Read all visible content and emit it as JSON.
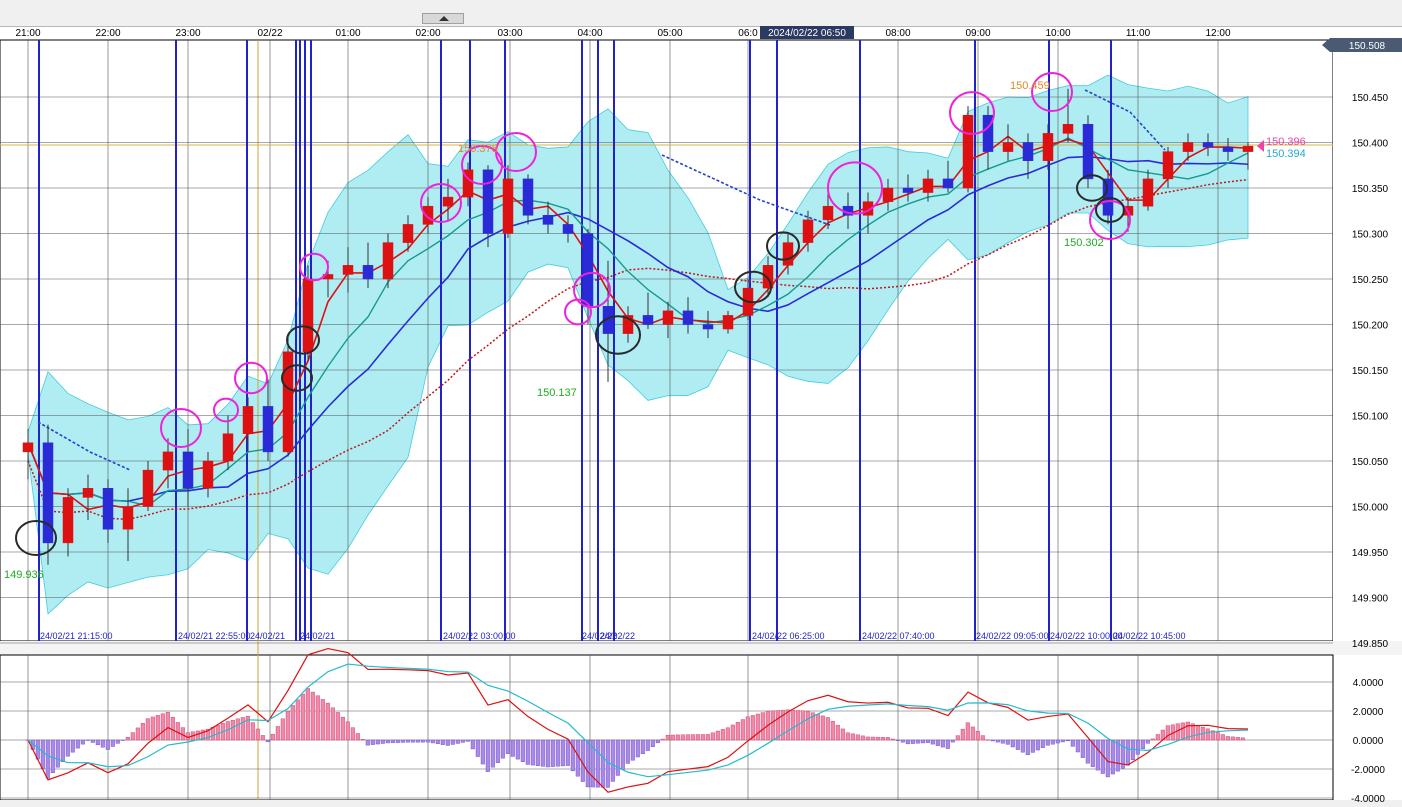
{
  "time_labels": [
    "21:00",
    "22:00",
    "23:00",
    "02/22",
    "01:00",
    "02:00",
    "03:00",
    "04:00",
    "05:00",
    "06:0",
    "08:00",
    "09:00",
    "10:00",
    "11:00",
    "12:00"
  ],
  "cursor_label": "2024/02/22 06:50",
  "price_axis": {
    "current_price_tag": "150.508",
    "ticks": [
      "150.450",
      "150.400",
      "150.350",
      "150.300",
      "150.250",
      "150.200",
      "150.150",
      "150.100",
      "150.050",
      "150.000",
      "149.950",
      "149.900",
      "149.850"
    ],
    "last_bid": "150.396",
    "last_ask": "150.394"
  },
  "annotations": {
    "low_1": "149.936",
    "low_2": "150.137",
    "high_1": "150.378",
    "high_2": "150.459",
    "low_3": "150.302"
  },
  "vline_labels": [
    "24/02/21 21:15:00",
    "24/02/21 22:55:00",
    "24/02/21",
    "24/02/21",
    "24/02/22 03:00:00",
    "24/02/22",
    "24/02/22",
    "24/02/22 06:25:00",
    "24/02/22 07:40:00",
    "24/02/22 09:05:00",
    "24/02/22 10:00:00",
    "24/02/22 10:45:00"
  ],
  "macd_axis": [
    "4.0000",
    "2.0000",
    "0.0000",
    "-2.0000",
    "-4.0000"
  ],
  "colors": {
    "bull_candle": "#dd1111",
    "bear_candle": "#2a2ad6",
    "band_fill": "#a8ecf2",
    "band_edge": "#2ec7d8",
    "ma_fast": "#dd1111",
    "ma_mid": "#169a8c",
    "ma_slow": "#2a2ad6",
    "event_line": "#2222cc",
    "highlight_circle": "#ee22dd",
    "support_circle": "#2a2a2a",
    "macd_line": "#dd1111",
    "signal_line": "#22bbcc",
    "hist_pos": "#f08aa8",
    "hist_neg": "#a98ae6"
  },
  "chart_data": {
    "type": "candlestick",
    "timeframe": "5m",
    "ylim": [
      149.85,
      150.51
    ],
    "series": [
      {
        "x": "21:00",
        "open": 150.06,
        "high": 150.085,
        "low": 150.03,
        "close": 150.07
      },
      {
        "x": "21:15",
        "open": 150.07,
        "high": 150.09,
        "low": 149.936,
        "close": 149.96
      },
      {
        "x": "21:30",
        "open": 149.96,
        "high": 150.02,
        "low": 149.945,
        "close": 150.01
      },
      {
        "x": "21:45",
        "open": 150.01,
        "high": 150.035,
        "low": 149.985,
        "close": 150.02
      },
      {
        "x": "22:00",
        "open": 150.02,
        "high": 150.03,
        "low": 149.96,
        "close": 149.975
      },
      {
        "x": "22:15",
        "open": 149.975,
        "high": 150.02,
        "low": 149.94,
        "close": 150.0
      },
      {
        "x": "22:30",
        "open": 150.0,
        "high": 150.05,
        "low": 149.995,
        "close": 150.04
      },
      {
        "x": "22:45",
        "open": 150.04,
        "high": 150.075,
        "low": 150.02,
        "close": 150.06
      },
      {
        "x": "23:00",
        "open": 150.06,
        "high": 150.085,
        "low": 150.0,
        "close": 150.02
      },
      {
        "x": "23:15",
        "open": 150.02,
        "high": 150.06,
        "low": 150.01,
        "close": 150.05
      },
      {
        "x": "23:30",
        "open": 150.05,
        "high": 150.1,
        "low": 150.04,
        "close": 150.08
      },
      {
        "x": "23:45",
        "open": 150.08,
        "high": 150.12,
        "low": 150.06,
        "close": 150.11
      },
      {
        "x": "00:00",
        "open": 150.11,
        "high": 150.14,
        "low": 150.05,
        "close": 150.06
      },
      {
        "x": "00:15",
        "open": 150.06,
        "high": 150.185,
        "low": 150.055,
        "close": 150.17
      },
      {
        "x": "00:30",
        "open": 150.17,
        "high": 150.265,
        "low": 150.16,
        "close": 150.25
      },
      {
        "x": "00:45",
        "open": 150.25,
        "high": 150.27,
        "low": 150.23,
        "close": 150.255
      },
      {
        "x": "01:00",
        "open": 150.255,
        "high": 150.285,
        "low": 150.235,
        "close": 150.265
      },
      {
        "x": "01:15",
        "open": 150.265,
        "high": 150.29,
        "low": 150.24,
        "close": 150.25
      },
      {
        "x": "01:30",
        "open": 150.25,
        "high": 150.3,
        "low": 150.24,
        "close": 150.29
      },
      {
        "x": "01:45",
        "open": 150.29,
        "high": 150.32,
        "low": 150.28,
        "close": 150.31
      },
      {
        "x": "02:00",
        "open": 150.31,
        "high": 150.34,
        "low": 150.3,
        "close": 150.33
      },
      {
        "x": "02:15",
        "open": 150.33,
        "high": 150.36,
        "low": 150.315,
        "close": 150.34
      },
      {
        "x": "02:30",
        "open": 150.34,
        "high": 150.378,
        "low": 150.33,
        "close": 150.37
      },
      {
        "x": "02:45",
        "open": 150.37,
        "high": 150.375,
        "low": 150.285,
        "close": 150.3
      },
      {
        "x": "03:00",
        "open": 150.3,
        "high": 150.375,
        "low": 150.295,
        "close": 150.36
      },
      {
        "x": "03:15",
        "open": 150.36,
        "high": 150.365,
        "low": 150.31,
        "close": 150.32
      },
      {
        "x": "03:30",
        "open": 150.32,
        "high": 150.335,
        "low": 150.3,
        "close": 150.31
      },
      {
        "x": "03:45",
        "open": 150.31,
        "high": 150.32,
        "low": 150.29,
        "close": 150.3
      },
      {
        "x": "04:00",
        "open": 150.3,
        "high": 150.305,
        "low": 150.2,
        "close": 150.22
      },
      {
        "x": "04:15",
        "open": 150.22,
        "high": 150.27,
        "low": 150.137,
        "close": 150.19
      },
      {
        "x": "04:30",
        "open": 150.19,
        "high": 150.22,
        "low": 150.18,
        "close": 150.21
      },
      {
        "x": "04:45",
        "open": 150.21,
        "high": 150.235,
        "low": 150.195,
        "close": 150.2
      },
      {
        "x": "05:00",
        "open": 150.2,
        "high": 150.225,
        "low": 150.185,
        "close": 150.215
      },
      {
        "x": "05:15",
        "open": 150.215,
        "high": 150.23,
        "low": 150.19,
        "close": 150.2
      },
      {
        "x": "05:30",
        "open": 150.2,
        "high": 150.215,
        "low": 150.185,
        "close": 150.195
      },
      {
        "x": "05:45",
        "open": 150.195,
        "high": 150.215,
        "low": 150.19,
        "close": 150.21
      },
      {
        "x": "06:00",
        "open": 150.21,
        "high": 150.25,
        "low": 150.205,
        "close": 150.24
      },
      {
        "x": "06:15",
        "open": 150.24,
        "high": 150.275,
        "low": 150.23,
        "close": 150.265
      },
      {
        "x": "06:30",
        "open": 150.265,
        "high": 150.3,
        "low": 150.255,
        "close": 150.29
      },
      {
        "x": "06:45",
        "open": 150.29,
        "high": 150.325,
        "low": 150.28,
        "close": 150.315
      },
      {
        "x": "07:00",
        "open": 150.315,
        "high": 150.345,
        "low": 150.305,
        "close": 150.33
      },
      {
        "x": "07:15",
        "open": 150.33,
        "high": 150.345,
        "low": 150.305,
        "close": 150.32
      },
      {
        "x": "07:30",
        "open": 150.32,
        "high": 150.345,
        "low": 150.3,
        "close": 150.335
      },
      {
        "x": "07:45",
        "open": 150.335,
        "high": 150.36,
        "low": 150.325,
        "close": 150.35
      },
      {
        "x": "08:00",
        "open": 150.35,
        "high": 150.365,
        "low": 150.335,
        "close": 150.345
      },
      {
        "x": "08:15",
        "open": 150.345,
        "high": 150.37,
        "low": 150.335,
        "close": 150.36
      },
      {
        "x": "08:30",
        "open": 150.36,
        "high": 150.38,
        "low": 150.345,
        "close": 150.35
      },
      {
        "x": "08:45",
        "open": 150.35,
        "high": 150.44,
        "low": 150.345,
        "close": 150.43
      },
      {
        "x": "09:00",
        "open": 150.43,
        "high": 150.44,
        "low": 150.37,
        "close": 150.39
      },
      {
        "x": "09:15",
        "open": 150.39,
        "high": 150.42,
        "low": 150.38,
        "close": 150.4
      },
      {
        "x": "09:30",
        "open": 150.4,
        "high": 150.41,
        "low": 150.36,
        "close": 150.38
      },
      {
        "x": "09:45",
        "open": 150.38,
        "high": 150.42,
        "low": 150.37,
        "close": 150.41
      },
      {
        "x": "10:00",
        "open": 150.41,
        "high": 150.459,
        "low": 150.4,
        "close": 150.42
      },
      {
        "x": "10:15",
        "open": 150.42,
        "high": 150.43,
        "low": 150.35,
        "close": 150.36
      },
      {
        "x": "10:30",
        "open": 150.36,
        "high": 150.37,
        "low": 150.31,
        "close": 150.32
      },
      {
        "x": "10:45",
        "open": 150.32,
        "high": 150.34,
        "low": 150.302,
        "close": 150.33
      },
      {
        "x": "11:00",
        "open": 150.33,
        "high": 150.37,
        "low": 150.325,
        "close": 150.36
      },
      {
        "x": "11:15",
        "open": 150.36,
        "high": 150.395,
        "low": 150.35,
        "close": 150.39
      },
      {
        "x": "11:30",
        "open": 150.39,
        "high": 150.41,
        "low": 150.38,
        "close": 150.4
      },
      {
        "x": "11:45",
        "open": 150.4,
        "high": 150.41,
        "low": 150.385,
        "close": 150.395
      },
      {
        "x": "12:00",
        "open": 150.395,
        "high": 150.405,
        "low": 150.38,
        "close": 150.39
      },
      {
        "x": "12:15",
        "open": 150.39,
        "high": 150.4,
        "low": 150.37,
        "close": 150.396
      }
    ]
  }
}
